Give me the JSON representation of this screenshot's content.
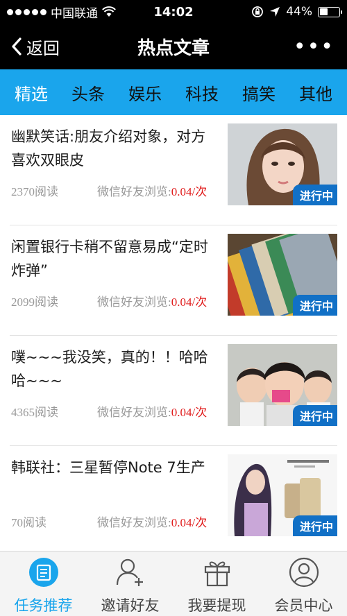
{
  "status_bar": {
    "carrier": "中国联通",
    "time": "14:02",
    "battery_percent": "44%",
    "battery_level": 0.44
  },
  "nav": {
    "back_label": "返回",
    "title": "热点文章",
    "more_label": "•••"
  },
  "tabs": [
    {
      "label": "精选",
      "active": true
    },
    {
      "label": "头条",
      "active": false
    },
    {
      "label": "娱乐",
      "active": false
    },
    {
      "label": "科技",
      "active": false
    },
    {
      "label": "搞笑",
      "active": false
    },
    {
      "label": "其他",
      "active": false
    }
  ],
  "articles": [
    {
      "title": "幽默笑话:朋友介绍对象，对方喜欢双眼皮",
      "reads": "2370阅读",
      "reward_label": "微信好友浏览:",
      "reward_price": "0.04/次",
      "badge": "进行中",
      "image": "girl-portrait"
    },
    {
      "title": "闲置银行卡稍不留意易成“定时炸弹”",
      "reads": "2099阅读",
      "reward_label": "微信好友浏览:",
      "reward_price": "0.04/次",
      "badge": "进行中",
      "image": "bank-cards"
    },
    {
      "title": "噗~~~我没笑，真的！！哈哈哈~~~",
      "reads": "4365阅读",
      "reward_label": "微信好友浏览:",
      "reward_price": "0.04/次",
      "badge": "进行中",
      "image": "kids-laughing"
    },
    {
      "title": "韩联社：三星暂停Note 7生产",
      "reads": "70阅读",
      "reward_label": "微信好友浏览:",
      "reward_price": "0.04/次",
      "badge": "进行中",
      "image": "samsung-ad"
    }
  ],
  "bottom_tabs": [
    {
      "label": "任务推荐",
      "icon": "document-icon",
      "active": true
    },
    {
      "label": "邀请好友",
      "icon": "add-user-icon",
      "active": false
    },
    {
      "label": "我要提现",
      "icon": "gift-icon",
      "active": false
    },
    {
      "label": "会员中心",
      "icon": "member-icon",
      "active": false
    }
  ],
  "colors": {
    "accent": "#1aa5ec",
    "price": "#e01a1a",
    "badge": "#1170c6"
  }
}
